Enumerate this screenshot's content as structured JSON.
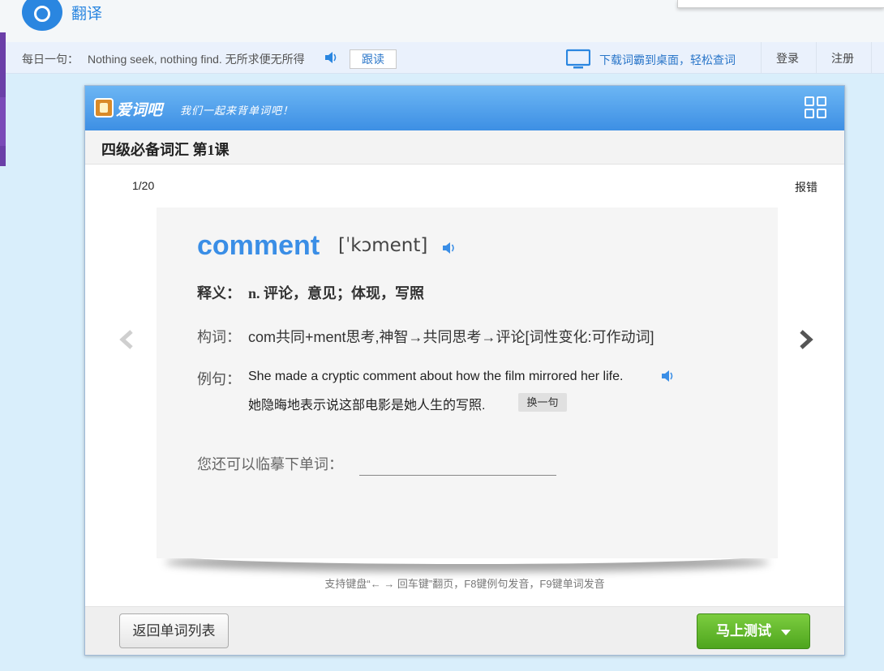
{
  "app": {
    "title": "翻译"
  },
  "daily": {
    "label": "每日一句：",
    "text": "Nothing seek, nothing find. 无所求便无所得",
    "follow_label": "跟读"
  },
  "nav": {
    "download_text": "下载词霸到桌面，轻松查词",
    "login_label": "登录",
    "register_label": "注册"
  },
  "panel": {
    "brand_name": "爱词吧",
    "brand_slogan": "我们一起来背单词吧！",
    "lesson_title": "四级必备词汇 第1课",
    "progress": "1/20",
    "report_label": "报错",
    "word": "comment",
    "phonetic": "[ˈkɔment]",
    "definition_label": "释义：",
    "definition": "n. 评论，意见；体现，写照",
    "structure_label": "构词：",
    "structure": "com共同+ment思考,神智→共同思考→评论[词性变化:可作动词]",
    "example_label": "例句：",
    "example_en": "She made a cryptic comment about how the film mirrored her life.",
    "example_zh": "她隐晦地表示说这部电影是她人生的写照.",
    "swap_label": "换一句",
    "copy_label": "您还可以临摹下单词：",
    "hint": "支持键盘“← → 回车键”翻页，F8键例句发音，F9键单词发音",
    "back_label": "返回单词列表",
    "test_label": "马上测试"
  },
  "colors": {
    "accent": "#3a8ee6",
    "header": "#4a9ae8",
    "test_button": "#5cb82a"
  },
  "icons": {
    "logo": "app-logo-icon",
    "speaker": "speaker-icon",
    "monitor": "monitor-icon",
    "grid": "grid-icon",
    "prev": "chevron-left-icon",
    "next": "chevron-right-icon",
    "caret": "caret-down-icon"
  }
}
